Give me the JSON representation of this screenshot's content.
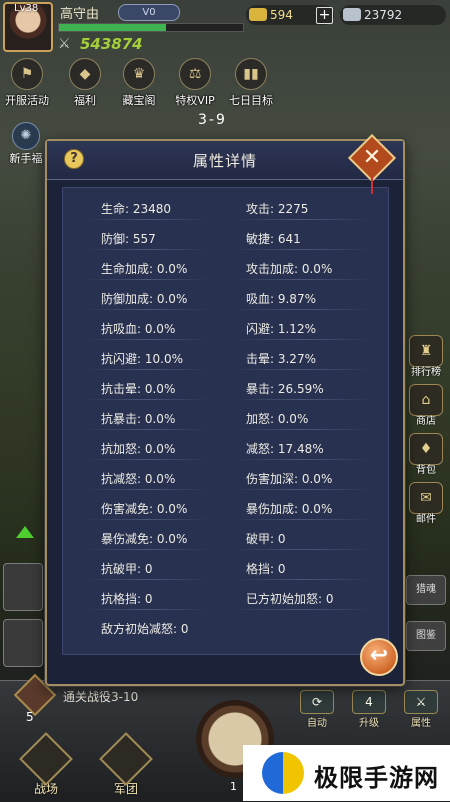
{
  "player": {
    "level": "Lv38",
    "name": "高守由",
    "vip": "V0",
    "power": "543874",
    "xp_progress": 0.58
  },
  "resources": {
    "gold": "594",
    "silver": "23792"
  },
  "top_menu": [
    {
      "label": "开服活动",
      "icon": "flag-icon"
    },
    {
      "label": "福利",
      "icon": "gift-icon"
    },
    {
      "label": "藏宝阁",
      "icon": "crown-icon"
    },
    {
      "label": "特权VIP",
      "icon": "scale-icon"
    },
    {
      "label": "七日目标",
      "icon": "bar-chart-icon"
    }
  ],
  "stage": "3-9",
  "left_side": {
    "label": "新手福",
    "icon": "atom-icon"
  },
  "right_menu": [
    {
      "label": "排行榜",
      "icon": "trophy-icon"
    },
    {
      "label": "商店",
      "icon": "shop-icon"
    },
    {
      "label": "背包",
      "icon": "bag-icon"
    },
    {
      "label": "邮件",
      "icon": "mail-icon"
    }
  ],
  "right_slots": [
    "猎魂",
    "图鉴"
  ],
  "bottom": {
    "task": "通关战役3-10",
    "task_count": "5",
    "auto_label": "自动",
    "upgrade_label": "升级",
    "upgrade_count": "4",
    "attr_label": "属性",
    "nav": [
      "战场",
      "军团"
    ],
    "page_num": "1"
  },
  "watermark": {
    "text": "极限手游网"
  },
  "dialog": {
    "title": "属性详情",
    "close_label": "✕",
    "help_label": "?",
    "attributes": [
      [
        "生命: 23480",
        "攻击: 2275"
      ],
      [
        "防御: 557",
        "敏捷: 641"
      ],
      [
        "生命加成: 0.0%",
        "攻击加成: 0.0%"
      ],
      [
        "防御加成: 0.0%",
        "吸血: 9.87%"
      ],
      [
        "抗吸血: 0.0%",
        "闪避: 1.12%"
      ],
      [
        "抗闪避: 10.0%",
        "击晕: 3.27%"
      ],
      [
        "抗击晕: 0.0%",
        "暴击: 26.59%"
      ],
      [
        "抗暴击: 0.0%",
        "加怒: 0.0%"
      ],
      [
        "抗加怒: 0.0%",
        "减怒: 17.48%"
      ],
      [
        "抗减怒: 0.0%",
        "伤害加深: 0.0%"
      ],
      [
        "伤害减免: 0.0%",
        "暴伤加成: 0.0%"
      ],
      [
        "暴伤减免: 0.0%",
        "破甲: 0"
      ],
      [
        "抗破甲: 0",
        "格挡: 0"
      ],
      [
        "抗格挡: 0",
        "已方初始加怒: 0"
      ],
      [
        "敌方初始减怒: 0",
        ""
      ]
    ]
  },
  "colors": {
    "dialog_bg": "#1c2339",
    "panel_bg": "#28314f",
    "frame_gold": "#a28e5e",
    "power_green": "#a4cf3a",
    "close_orange": "#b34a1e"
  }
}
